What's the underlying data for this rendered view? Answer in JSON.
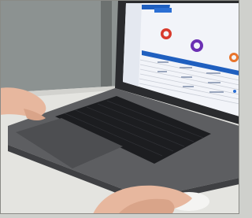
{
  "photo": {
    "subject": "",
    "colors": {
      "wall": "#8e9493",
      "desk": "#e6e6e2",
      "laptop_body": "#5a5b5e",
      "keyboard": "#1c1d20",
      "screen_bg": "#f4f6fb",
      "screen_header": "#1f5fbf",
      "accent_red": "#d83a2c",
      "accent_purple": "#6b2fb3",
      "accent_orange": "#e8742c",
      "skin": "#e7b79e"
    }
  }
}
